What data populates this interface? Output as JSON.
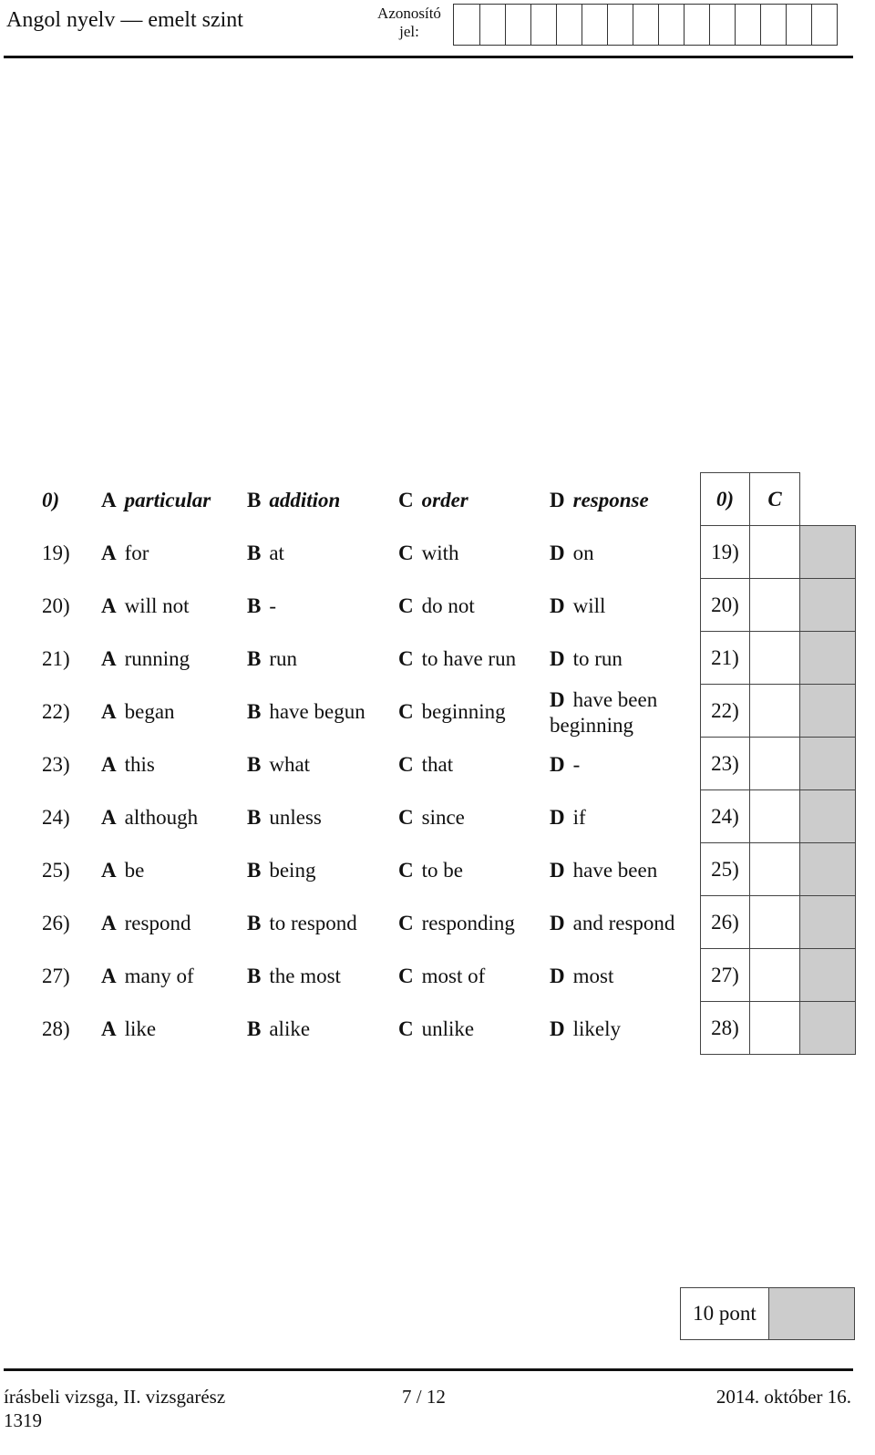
{
  "header": {
    "title": "Angol nyelv — emelt szint",
    "id_label_line1": "Azonosító",
    "id_label_line2": "jel:",
    "id_cells": 15
  },
  "example": {
    "num": "0)",
    "options": [
      {
        "letter": "A",
        "text": "particular"
      },
      {
        "letter": "B",
        "text": "addition"
      },
      {
        "letter": "C",
        "text": "order"
      },
      {
        "letter": "D",
        "text": "response"
      }
    ],
    "answer_num": "0)",
    "answer": "C"
  },
  "questions": [
    {
      "num": "19)",
      "options": [
        {
          "letter": "A",
          "text": "for"
        },
        {
          "letter": "B",
          "text": "at"
        },
        {
          "letter": "C",
          "text": "with"
        },
        {
          "letter": "D",
          "text": "on"
        }
      ]
    },
    {
      "num": "20)",
      "options": [
        {
          "letter": "A",
          "text": "will not"
        },
        {
          "letter": "B",
          "text": "-"
        },
        {
          "letter": "C",
          "text": "do not"
        },
        {
          "letter": "D",
          "text": "will"
        }
      ]
    },
    {
      "num": "21)",
      "options": [
        {
          "letter": "A",
          "text": "running"
        },
        {
          "letter": "B",
          "text": "run"
        },
        {
          "letter": "C",
          "text": "to have run"
        },
        {
          "letter": "D",
          "text": "to run"
        }
      ]
    },
    {
      "num": "22)",
      "options": [
        {
          "letter": "A",
          "text": "began"
        },
        {
          "letter": "B",
          "text": "have begun"
        },
        {
          "letter": "C",
          "text": "beginning"
        },
        {
          "letter": "D",
          "text": "have been beginning"
        }
      ]
    },
    {
      "num": "23)",
      "options": [
        {
          "letter": "A",
          "text": "this"
        },
        {
          "letter": "B",
          "text": "what"
        },
        {
          "letter": "C",
          "text": "that"
        },
        {
          "letter": "D",
          "text": "-"
        }
      ]
    },
    {
      "num": "24)",
      "options": [
        {
          "letter": "A",
          "text": "although"
        },
        {
          "letter": "B",
          "text": "unless"
        },
        {
          "letter": "C",
          "text": "since"
        },
        {
          "letter": "D",
          "text": "if"
        }
      ]
    },
    {
      "num": "25)",
      "options": [
        {
          "letter": "A",
          "text": "be"
        },
        {
          "letter": "B",
          "text": "being"
        },
        {
          "letter": "C",
          "text": "to be"
        },
        {
          "letter": "D",
          "text": "have been"
        }
      ]
    },
    {
      "num": "26)",
      "options": [
        {
          "letter": "A",
          "text": "respond"
        },
        {
          "letter": "B",
          "text": "to respond"
        },
        {
          "letter": "C",
          "text": "responding"
        },
        {
          "letter": "D",
          "text": "and respond"
        }
      ]
    },
    {
      "num": "27)",
      "options": [
        {
          "letter": "A",
          "text": "many of"
        },
        {
          "letter": "B",
          "text": "the most"
        },
        {
          "letter": "C",
          "text": "most of"
        },
        {
          "letter": "D",
          "text": "most"
        }
      ]
    },
    {
      "num": "28)",
      "options": [
        {
          "letter": "A",
          "text": "like"
        },
        {
          "letter": "B",
          "text": "alike"
        },
        {
          "letter": "C",
          "text": "unlike"
        },
        {
          "letter": "D",
          "text": "likely"
        }
      ]
    }
  ],
  "score": {
    "label": "10 pont"
  },
  "footer": {
    "left": "írásbeli vizsga, II. vizsgarész",
    "code": "1319",
    "page": "7 / 12",
    "date": "2014. október 16."
  }
}
